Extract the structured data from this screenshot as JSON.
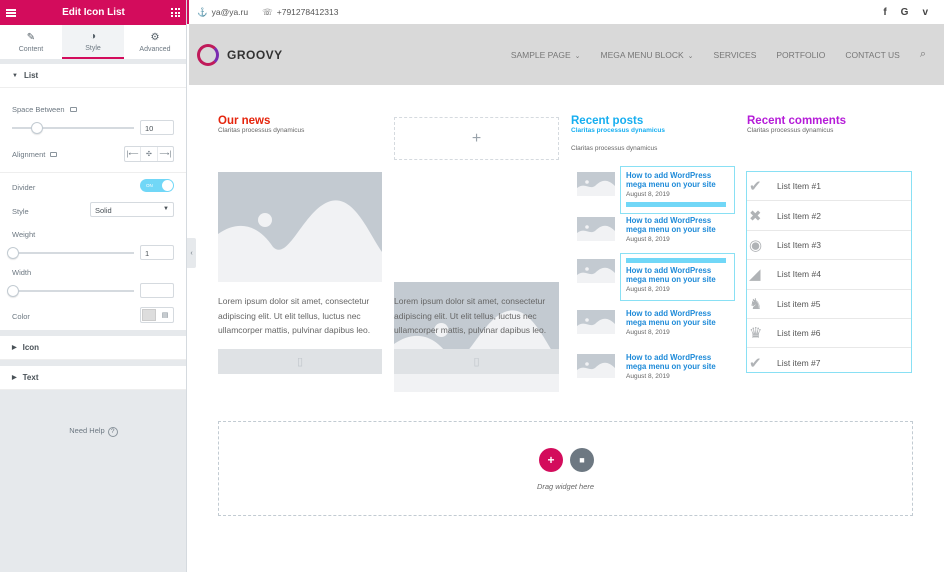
{
  "panel": {
    "title": "Edit Icon List",
    "tabs": [
      {
        "label": "Content",
        "icon": "pencil-icon"
      },
      {
        "label": "Style",
        "icon": "contrast-icon"
      },
      {
        "label": "Advanced",
        "icon": "gear-icon"
      }
    ],
    "sections": {
      "list": "List",
      "icon": "Icon",
      "text": "Text"
    },
    "controls": {
      "space_between_label": "Space Between",
      "space_between_value": "10",
      "space_between_fraction": 0.2,
      "alignment_label": "Alignment",
      "alignment_options": [
        "left",
        "center",
        "right"
      ],
      "divider_label": "Divider",
      "divider_state": "ON",
      "style_label": "Style",
      "style_value": "Solid",
      "weight_label": "Weight",
      "weight_value": "1",
      "width_label": "Width",
      "width_value": "",
      "color_label": "Color",
      "color_value": "#dddddd"
    },
    "need_help": "Need Help",
    "accent": "#d30c5c"
  },
  "topbar": {
    "email": "ya@ya.ru",
    "phone": "+791278412313",
    "social": [
      "f",
      "G",
      "v"
    ]
  },
  "nav": {
    "logo": "GROOVY",
    "items": [
      {
        "label": "SAMPLE PAGE",
        "dropdown": true
      },
      {
        "label": "MEGA MENU BLOCK",
        "dropdown": true
      },
      {
        "label": "SERVICES",
        "dropdown": false
      },
      {
        "label": "PORTFOLIO",
        "dropdown": false
      },
      {
        "label": "CONTACT US",
        "dropdown": false
      }
    ]
  },
  "news": {
    "title": "Our news",
    "subtitle": "Claritas processus dynamicus",
    "title_color": "#e5240c",
    "body": "Lorem ipsum dolor sit amet, consectetur adipiscing elit. Ut elit tellus, luctus nec ullamcorper mattis, pulvinar dapibus leo.",
    "add_placeholder": "+"
  },
  "posts": {
    "title": "Recent posts",
    "subtitle_colored": "Claritas processus dynamicus",
    "subtitle": "Claritas processus dynamicus",
    "title_color": "#16aef0",
    "items": [
      {
        "title": "How to add WordPress mega menu on your site",
        "date": "August 8, 2019"
      },
      {
        "title": "How to add WordPress mega menu on your site",
        "date": "August 8, 2019"
      },
      {
        "title": "How to add WordPress mega menu on your site",
        "date": "August 8, 2019"
      },
      {
        "title": "How to add WordPress mega menu on your site",
        "date": "August 8, 2019"
      },
      {
        "title": "How to add WordPress mega menu on your site",
        "date": "August 8, 2019"
      }
    ]
  },
  "comments": {
    "title": "Recent comments",
    "subtitle": "Claritas processus dynamicus",
    "title_color": "#b51bd8",
    "items": [
      {
        "label": "List Item #1",
        "icon": "check-icon"
      },
      {
        "label": "List Item #2",
        "icon": "times-icon"
      },
      {
        "label": "List Item #3",
        "icon": "circle-icon"
      },
      {
        "label": "List Item #4",
        "icon": "cheese-icon"
      },
      {
        "label": "List item #5",
        "icon": "chess-knight-icon"
      },
      {
        "label": "List item #6",
        "icon": "chess-queen-icon"
      },
      {
        "label": "List item #7",
        "icon": "check-icon"
      }
    ]
  },
  "dropzone": {
    "hint": "Drag widget here"
  }
}
